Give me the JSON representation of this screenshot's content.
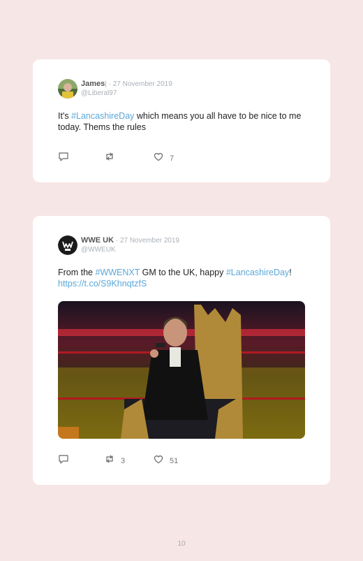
{
  "tweets": [
    {
      "name": "James",
      "separator": "| · ",
      "date": "27 November 2019",
      "handle": "@Liberal97",
      "text_before": "It's ",
      "hashtag": "#LancashireDay",
      "text_after": " which means you all have to be nice to me today. Thems the rules",
      "replies": "",
      "retweets": "",
      "likes": "7"
    },
    {
      "name": "WWE UK",
      "separator": " · ",
      "date": "27 November 2019",
      "handle": "@WWEUK",
      "text_part1": "From the ",
      "hashtag1": "#WWENXT",
      "text_part2": " GM to the UK, happy ",
      "hashtag2": "#LancashireDay",
      "text_part3": "! ",
      "url": "https://t.co/S9KhnqtzfS",
      "replies": "",
      "retweets": "3",
      "likes": "51"
    }
  ],
  "page_number": "10",
  "colors": {
    "background": "#f7e6e6",
    "link": "#5aa7d8",
    "card": "#ffffff"
  },
  "icons": [
    "reply-icon",
    "retweet-icon",
    "like-icon"
  ]
}
